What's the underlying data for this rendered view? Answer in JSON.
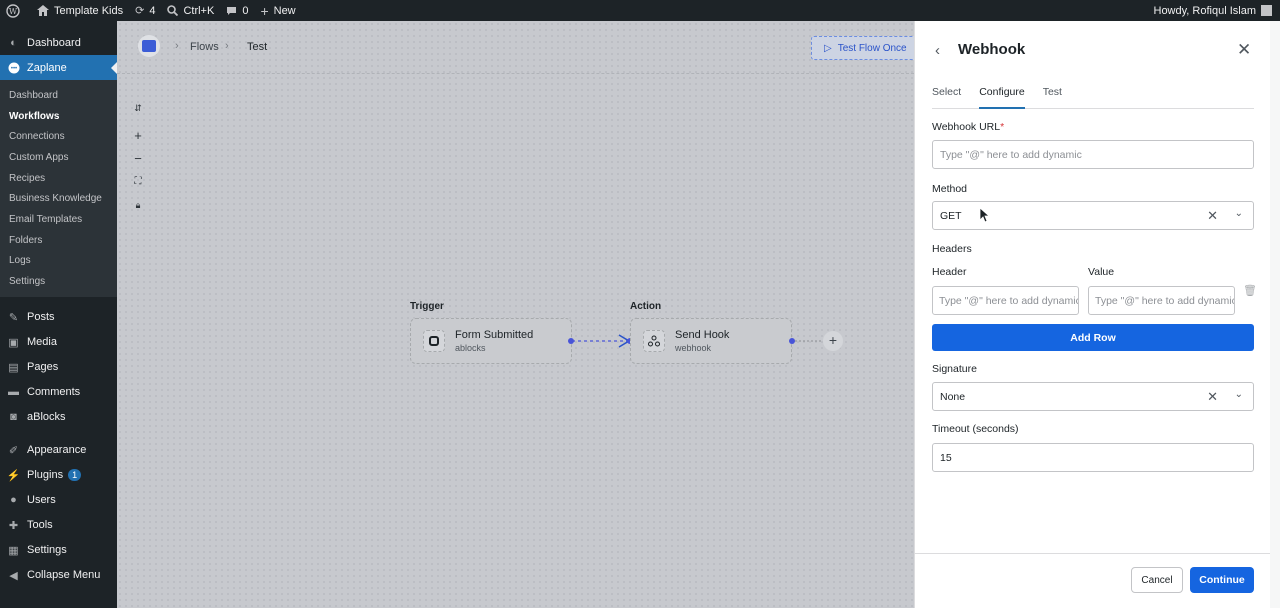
{
  "admin_bar": {
    "site_name": "Template Kids",
    "updates_count": "4",
    "search_shortcut": "Ctrl+K",
    "comments_count": "0",
    "new_label": "New",
    "greeting": "Howdy, Rofiqul Islam"
  },
  "sidebar": {
    "dashboard": "Dashboard",
    "zaplane": "Zaplane",
    "submenu": [
      "Dashboard",
      "Workflows",
      "Connections",
      "Custom Apps",
      "Recipes",
      "Business Knowledge",
      "Email Templates",
      "Folders",
      "Logs",
      "Settings"
    ],
    "posts": "Posts",
    "media": "Media",
    "pages": "Pages",
    "comments": "Comments",
    "ablocks": "aBlocks",
    "appearance": "Appearance",
    "plugins": "Plugins",
    "plugins_badge": "1",
    "users": "Users",
    "tools": "Tools",
    "settings": "Settings",
    "collapse": "Collapse Menu"
  },
  "canvas": {
    "breadcrumb": [
      "Flows",
      "Test"
    ],
    "test_button": "Test Flow Once",
    "trigger_label": "Trigger",
    "action_label": "Action",
    "trigger_node": {
      "title": "Form Submitted",
      "subtitle": "ablocks"
    },
    "action_node": {
      "title": "Send Hook",
      "subtitle": "webhook"
    }
  },
  "panel": {
    "title": "Webhook",
    "tabs": [
      "Select",
      "Configure",
      "Test"
    ],
    "webhook_url_label": "Webhook URL",
    "required_mark": "*",
    "webhook_url_placeholder": "Type \"@\" here to add dynamic",
    "method_label": "Method",
    "method_value": "GET",
    "headers_label": "Headers",
    "header_col": "Header",
    "value_col": "Value",
    "header_placeholder": "Type \"@\" here to add dynamic",
    "value_placeholder": "Type \"@\" here to add dynamic",
    "add_row": "Add Row",
    "signature_label": "Signature",
    "signature_value": "None",
    "timeout_label": "Timeout (seconds)",
    "timeout_value": "15",
    "cancel": "Cancel",
    "continue": "Continue"
  }
}
